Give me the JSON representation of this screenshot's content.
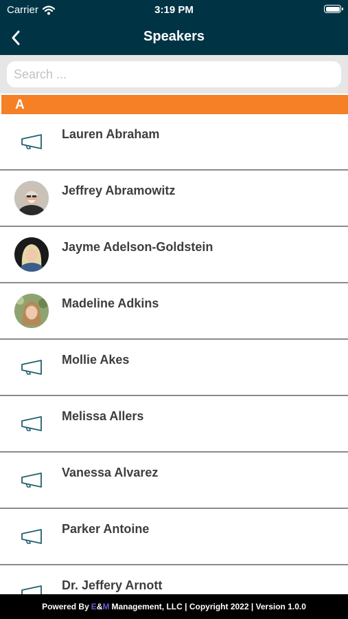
{
  "status_bar": {
    "carrier": "Carrier",
    "time": "3:19 PM",
    "battery_level": 1.0
  },
  "nav": {
    "title": "Speakers",
    "back_icon": "chevron-left-icon"
  },
  "search": {
    "placeholder": "Search ..."
  },
  "section": {
    "letter": "A"
  },
  "speakers": [
    {
      "name": "Lauren Abraham",
      "avatar": "megaphone-icon"
    },
    {
      "name": "Jeffrey Abramowitz",
      "avatar": "photo"
    },
    {
      "name": "Jayme Adelson-Goldstein",
      "avatar": "photo"
    },
    {
      "name": "Madeline Adkins",
      "avatar": "photo"
    },
    {
      "name": "Mollie Akes",
      "avatar": "megaphone-icon"
    },
    {
      "name": "Melissa Allers",
      "avatar": "megaphone-icon"
    },
    {
      "name": "Vanessa Alvarez",
      "avatar": "megaphone-icon"
    },
    {
      "name": "Parker Antoine",
      "avatar": "megaphone-icon"
    },
    {
      "name": "Dr. Jeffery Arnott",
      "avatar": "megaphone-icon"
    }
  ],
  "footer": {
    "prefix": "Powered By",
    "brand_e": "E",
    "brand_amp": "&",
    "brand_m": "M",
    "suffix": "Management, LLC | Copyright 2022 | Version 1.0.0"
  },
  "colors": {
    "header": "#003445",
    "section": "#f58025",
    "icon": "#1f5f6e",
    "footer": "#000000"
  }
}
